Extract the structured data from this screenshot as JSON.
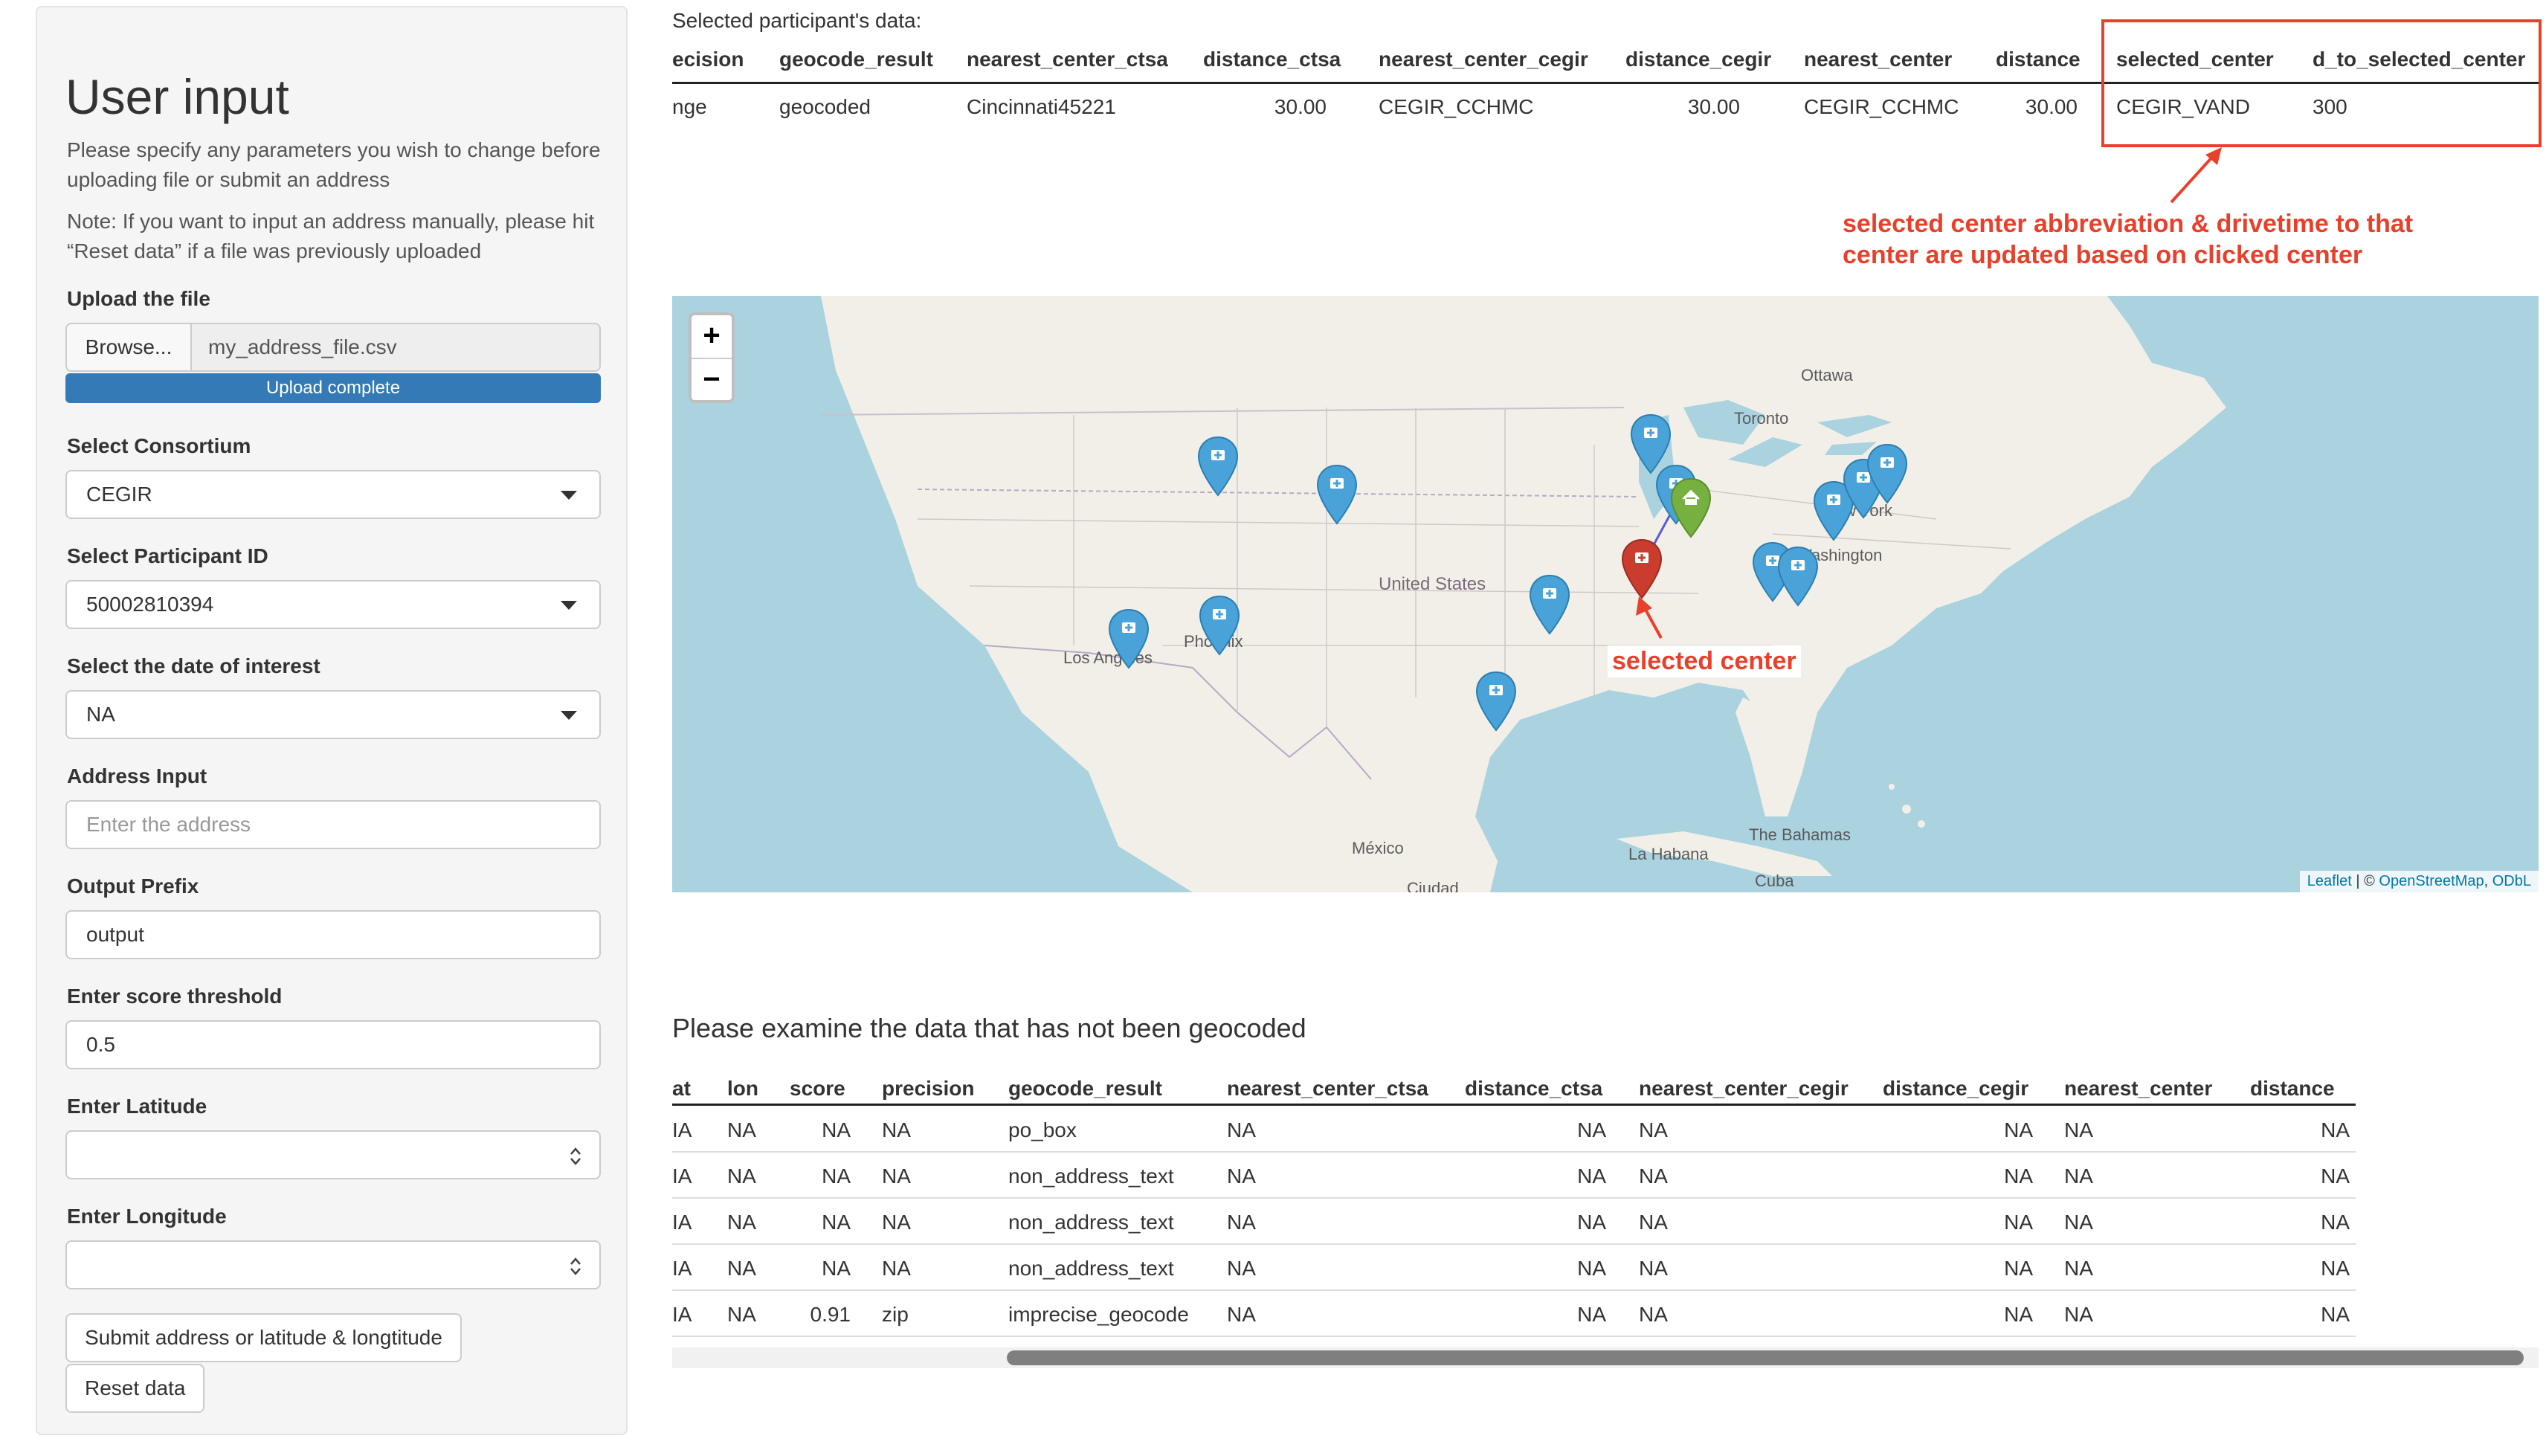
{
  "sidebar": {
    "title": "User input",
    "intro": "Please specify any parameters you wish to change before uploading file or submit an address",
    "note": "Note: If you want to input an address manually, please hit “Reset data” if a file was previously uploaded",
    "upload": {
      "label": "Upload the file",
      "browse_label": "Browse...",
      "file_name": "my_address_file.csv",
      "progress_text": "Upload complete",
      "progress": 1.0
    },
    "consortium": {
      "label": "Select Consortium",
      "value": "CEGIR"
    },
    "participant": {
      "label": "Select Participant ID",
      "value": "50002810394"
    },
    "date": {
      "label": "Select the date of interest",
      "value": "NA"
    },
    "address": {
      "label": "Address Input",
      "placeholder": "Enter the address",
      "value": ""
    },
    "prefix": {
      "label": "Output Prefix",
      "value": "output"
    },
    "threshold": {
      "label": "Enter score threshold",
      "value": "0.5"
    },
    "latitude": {
      "label": "Enter Latitude",
      "value": ""
    },
    "longitude": {
      "label": "Enter Longitude",
      "value": ""
    },
    "submit_label": "Submit address or latitude & longtitude",
    "reset_label": "Reset data"
  },
  "top_table": {
    "caption": "Selected participant's data:",
    "headers": [
      "ecision",
      "geocode_result",
      "nearest_center_ctsa",
      "distance_ctsa",
      "nearest_center_cegir",
      "distance_cegir",
      "nearest_center",
      "distance",
      "selected_center",
      "d_to_selected_center"
    ],
    "row": [
      "nge",
      "geocoded",
      "Cincinnati45221",
      "30.00",
      "CEGIR_CCHMC",
      "30.00",
      "CEGIR_CCHMC",
      "30.00",
      "CEGIR_VAND",
      "300"
    ]
  },
  "annotations": {
    "table_note_line1": "selected center abbreviation & drivetime to that",
    "table_note_line2": "center are updated based on clicked center",
    "selected_center_label": "selected center",
    "color": "#e8402b"
  },
  "map": {
    "zoom_in": "+",
    "zoom_out": "−",
    "labels": [
      "Ottawa",
      "Toronto",
      "New York",
      "Washington",
      "United States",
      "Los Angeles",
      "Phoenix",
      "México",
      "La Habana",
      "The Bahamas",
      "Cuba",
      "Ciudad"
    ],
    "attribution": {
      "leaflet": "Leaflet",
      "sep": " | © ",
      "osm": "OpenStreetMap",
      "comma": ", ",
      "odbl": "ODbL"
    },
    "colors": {
      "water": "#aad3df",
      "land": "#f2efe9",
      "center_marker": "#4aa3d8",
      "selected_marker": "#c93c2e",
      "home_marker": "#76b041"
    }
  },
  "bottom_table": {
    "title": "Please examine the data that has not been geocoded",
    "headers": [
      "at",
      "lon",
      "score",
      "precision",
      "geocode_result",
      "nearest_center_ctsa",
      "distance_ctsa",
      "nearest_center_cegir",
      "distance_cegir",
      "nearest_center",
      "distance"
    ],
    "rows": [
      [
        "IA",
        "NA",
        "NA",
        "NA",
        "po_box",
        "NA",
        "NA",
        "NA",
        "NA",
        "NA",
        "NA"
      ],
      [
        "IA",
        "NA",
        "NA",
        "NA",
        "non_address_text",
        "NA",
        "NA",
        "NA",
        "NA",
        "NA",
        "NA"
      ],
      [
        "IA",
        "NA",
        "NA",
        "NA",
        "non_address_text",
        "NA",
        "NA",
        "NA",
        "NA",
        "NA",
        "NA"
      ],
      [
        "IA",
        "NA",
        "NA",
        "NA",
        "non_address_text",
        "NA",
        "NA",
        "NA",
        "NA",
        "NA",
        "NA"
      ],
      [
        "IA",
        "NA",
        "0.91",
        "zip",
        "imprecise_geocode",
        "NA",
        "NA",
        "NA",
        "NA",
        "NA",
        "NA"
      ]
    ]
  }
}
